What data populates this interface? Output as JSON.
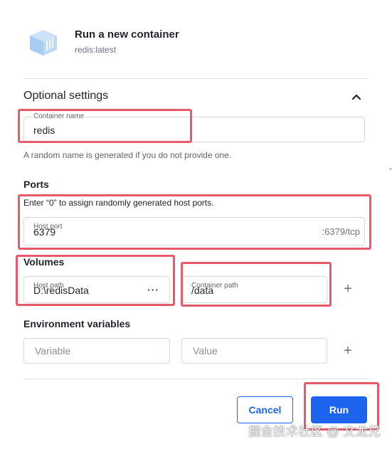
{
  "header": {
    "title": "Run a new container",
    "image": "redis:latest",
    "icon": "container-box-icon"
  },
  "optional": {
    "title": "Optional settings",
    "toggle_icon": "chevron-up-icon"
  },
  "container_name": {
    "label": "Container name",
    "value": "redis",
    "helper": "A random name is generated if you do not provide one."
  },
  "ports": {
    "title": "Ports",
    "helper": "Enter “0” to assign randomly generated host ports.",
    "host_port_label": "Host port",
    "host_port_value": "6379",
    "container_port": ":6379/tcp"
  },
  "volumes": {
    "title": "Volumes",
    "host_path_label": "Host path",
    "host_path_value": "D:\\redisData",
    "browse_label": "···",
    "container_path_label": "Container path",
    "container_path_value": "/data",
    "add_label": "+"
  },
  "env": {
    "title": "Environment variables",
    "variable_placeholder": "Variable",
    "value_placeholder": "Value",
    "add_label": "+"
  },
  "actions": {
    "cancel": "Cancel",
    "run": "Run"
  },
  "watermark": "掘金技术社区 @ 文龙兄",
  "colors": {
    "accent": "#1d63ed",
    "highlight": "#e8596b"
  }
}
